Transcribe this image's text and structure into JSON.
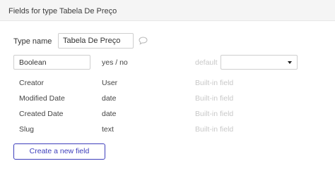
{
  "header": {
    "title": "Fields for type Tabela De Preço"
  },
  "type_name": {
    "label": "Type name",
    "value": "Tabela De Preço"
  },
  "fields": [
    {
      "name": "Boolean",
      "type": "yes / no",
      "note": "default",
      "default_value": ""
    },
    {
      "name": "Creator",
      "type": "User",
      "note": "Built-in field"
    },
    {
      "name": "Modified Date",
      "type": "date",
      "note": "Built-in field"
    },
    {
      "name": "Created Date",
      "type": "date",
      "note": "Built-in field"
    },
    {
      "name": "Slug",
      "type": "text",
      "note": "Built-in field"
    }
  ],
  "create_button": {
    "label": "Create a new field"
  },
  "colors": {
    "accent": "#3d3ebc",
    "muted": "#c8c8c8",
    "border": "#cfcfcf",
    "header_bg": "#f5f5f5"
  },
  "icons": {
    "comment": "speech-bubble-icon",
    "select": "caret-down-icon"
  }
}
